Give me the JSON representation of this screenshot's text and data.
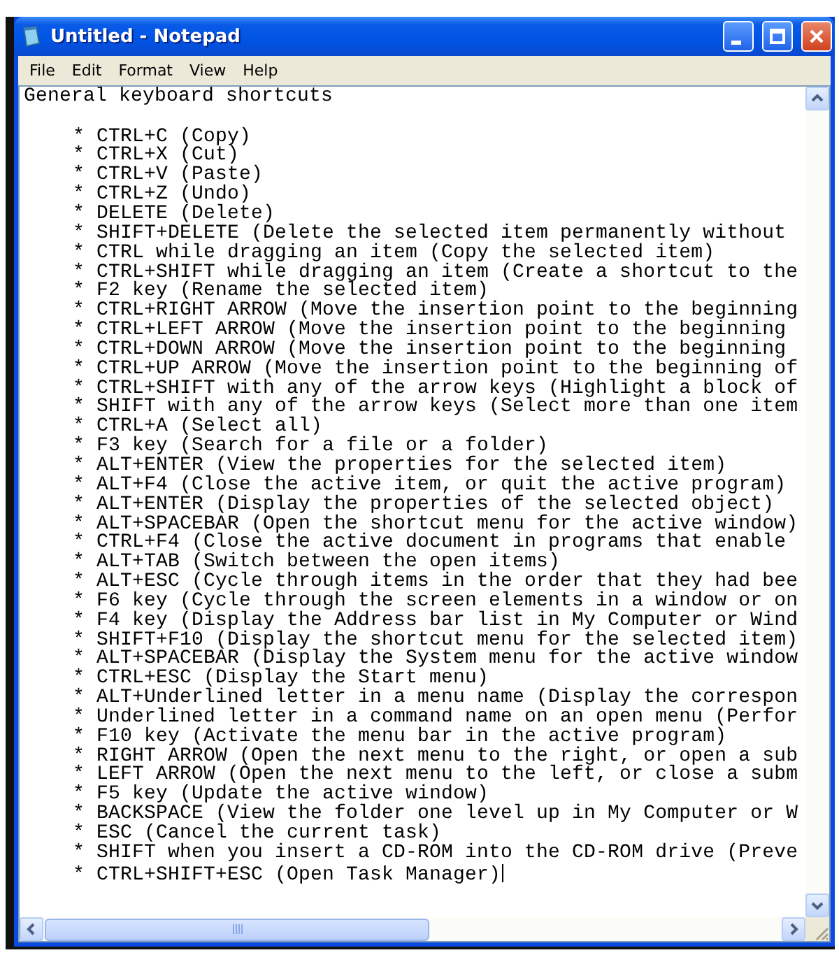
{
  "window": {
    "title": "Untitled - Notepad"
  },
  "menu": [
    "File",
    "Edit",
    "Format",
    "View",
    "Help"
  ],
  "document": {
    "heading": "General keyboard shortcuts",
    "lines": [
      "* CTRL+C (Copy)",
      "* CTRL+X (Cut)",
      "* CTRL+V (Paste)",
      "* CTRL+Z (Undo)",
      "* DELETE (Delete)",
      "* SHIFT+DELETE (Delete the selected item permanently without",
      "* CTRL while dragging an item (Copy the selected item)",
      "* CTRL+SHIFT while dragging an item (Create a shortcut to the",
      "* F2 key (Rename the selected item)",
      "* CTRL+RIGHT ARROW (Move the insertion point to the beginning",
      "* CTRL+LEFT ARROW (Move the insertion point to the beginning",
      "* CTRL+DOWN ARROW (Move the insertion point to the beginning",
      "* CTRL+UP ARROW (Move the insertion point to the beginning of",
      "* CTRL+SHIFT with any of the arrow keys (Highlight a block of",
      "* SHIFT with any of the arrow keys (Select more than one item",
      "* CTRL+A (Select all)",
      "* F3 key (Search for a file or a folder)",
      "* ALT+ENTER (View the properties for the selected item)",
      "* ALT+F4 (Close the active item, or quit the active program)",
      "* ALT+ENTER (Display the properties of the selected object)",
      "* ALT+SPACEBAR (Open the shortcut menu for the active window)",
      "* CTRL+F4 (Close the active document in programs that enable",
      "* ALT+TAB (Switch between the open items)",
      "* ALT+ESC (Cycle through items in the order that they had bee",
      "* F6 key (Cycle through the screen elements in a window or on",
      "* F4 key (Display the Address bar list in My Computer or Wind",
      "* SHIFT+F10 (Display the shortcut menu for the selected item)",
      "* ALT+SPACEBAR (Display the System menu for the active window",
      "* CTRL+ESC (Display the Start menu)",
      "* ALT+Underlined letter in a menu name (Display the correspon",
      "* Underlined letter in a command name on an open menu (Perfor",
      "* F10 key (Activate the menu bar in the active program)",
      "* RIGHT ARROW (Open the next menu to the right, or open a sub",
      "* LEFT ARROW (Open the next menu to the left, or close a subm",
      "* F5 key (Update the active window)",
      "* BACKSPACE (View the folder one level up in My Computer or W",
      "* ESC (Cancel the current task)",
      "* SHIFT when you insert a CD-ROM into the CD-ROM drive (Preve",
      "* CTRL+SHIFT+ESC (Open Task Manager)"
    ]
  }
}
